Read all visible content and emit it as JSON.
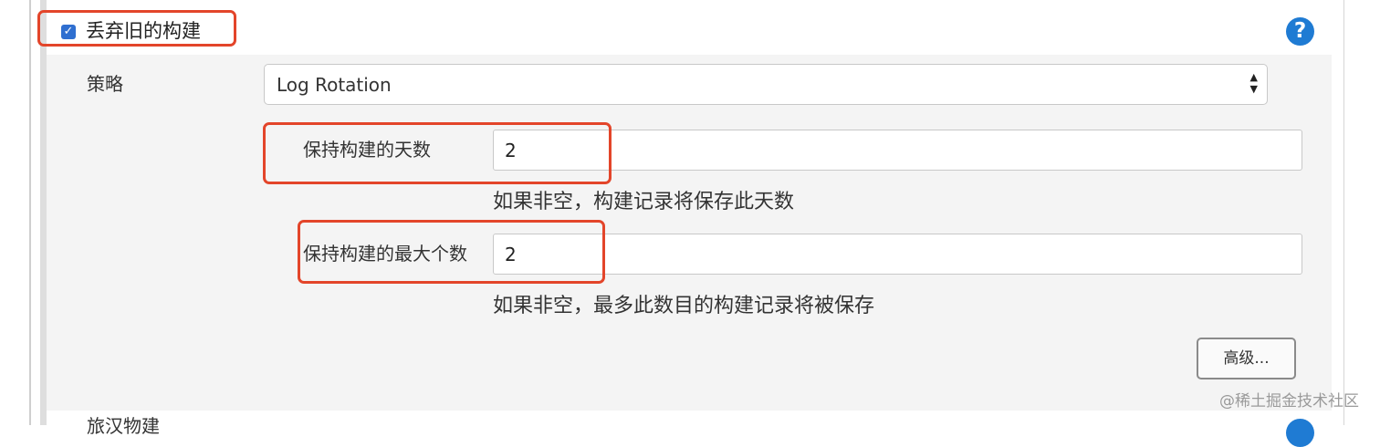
{
  "discard_old_builds": {
    "label": "丢弃旧的构建",
    "checked": true,
    "check_glyph": "✓"
  },
  "help": {
    "glyph": "?",
    "icon": "help-icon"
  },
  "strategy": {
    "label": "策略",
    "selected": "Log Rotation",
    "arrow_up": "▲",
    "arrow_down": "▼"
  },
  "days_to_keep": {
    "label": "保持构建的天数",
    "value": "2",
    "hint": "如果非空，构建记录将保存此天数"
  },
  "max_builds": {
    "label": "保持构建的最大个数",
    "value": "2",
    "hint": "如果非空，最多此数目的构建记录将被保存"
  },
  "advanced_button": {
    "label": "高级..."
  },
  "next_section": {
    "label": "旅汉物建"
  },
  "watermark": "@稀土掘金技术社区",
  "colors": {
    "checkbox": "#2f6fd0",
    "help": "#1f7bd3",
    "highlight": "#e3452a",
    "panel": "#f4f4f4"
  }
}
